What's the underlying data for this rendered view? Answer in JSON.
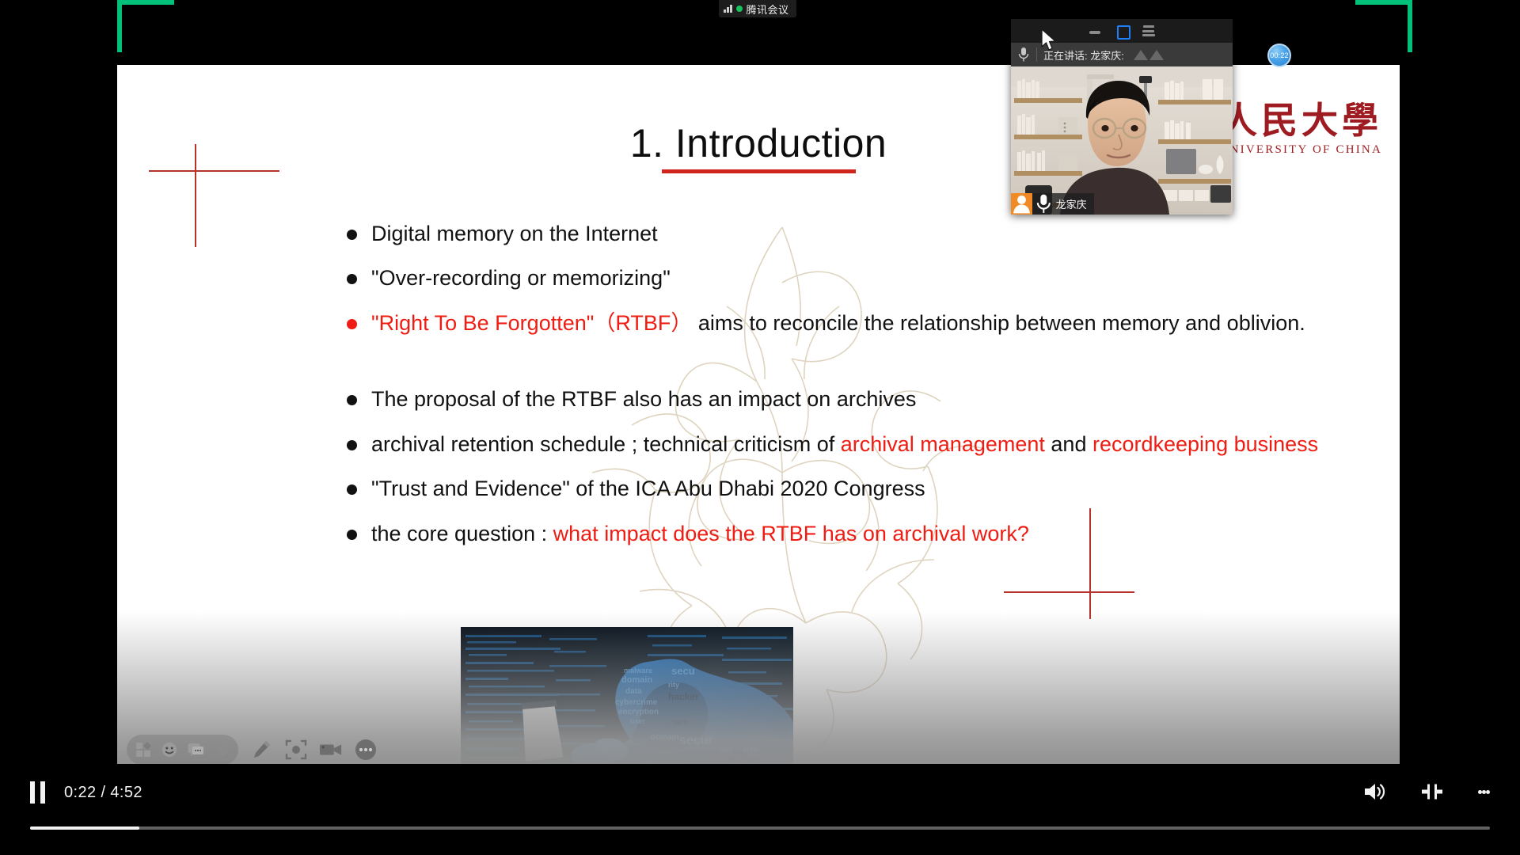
{
  "meeting_badge": {
    "label": "腾讯会议",
    "signal_icon": "signal-bars-icon",
    "status_icon": "green-dot-icon"
  },
  "timer_pill": {
    "value": "00:22"
  },
  "pip_window": {
    "titlebar": {
      "minimize_icon": "minimize-icon",
      "maximize_icon": "maximize-icon",
      "menu_icon": "hamburger-menu-icon"
    },
    "speaking_bar": {
      "mic_icon": "microphone-icon",
      "text": "正在讲话: 龙家庆:",
      "wave_icon": "audio-wave-icon"
    },
    "nametag": {
      "avatar_icon": "person-avatar-icon",
      "mic_icon": "microphone-icon",
      "name": "龙家庆"
    }
  },
  "slide": {
    "title": "1. Introduction",
    "university_logo": {
      "cn": "国人民大學",
      "en": "IN UNIVERSITY OF CHINA"
    },
    "bullets": [
      {
        "color": "black",
        "segments": [
          {
            "text": "Digital memory on the Internet",
            "color": "black"
          }
        ]
      },
      {
        "color": "black",
        "segments": [
          {
            "text": "\"Over-recording or memorizing\"",
            "color": "black"
          }
        ]
      },
      {
        "color": "red",
        "segments": [
          {
            "text": "\"Right To Be Forgotten\"（RTBF）",
            "color": "red"
          },
          {
            "text": " aims to reconcile the relationship between memory and oblivion.",
            "color": "black"
          }
        ]
      },
      {
        "color": "black",
        "spacer_before": true,
        "segments": [
          {
            "text": "The proposal of the RTBF also has an impact on archives",
            "color": "black"
          }
        ]
      },
      {
        "color": "black",
        "segments": [
          {
            "text": "archival retention schedule ; technical criticism of ",
            "color": "black"
          },
          {
            "text": "archival management",
            "color": "red"
          },
          {
            "text": " and ",
            "color": "black"
          },
          {
            "text": "recordkeeping business",
            "color": "red"
          }
        ]
      },
      {
        "color": "black",
        "segments": [
          {
            "text": "\"Trust and Evidence\" of the ICA Abu Dhabi 2020 Congress",
            "color": "black"
          }
        ]
      },
      {
        "color": "black",
        "segments": [
          {
            "text": "the core question : ",
            "color": "black"
          },
          {
            "text": "what impact does the RTBF has on archival work?",
            "color": "red"
          }
        ]
      }
    ],
    "image": {
      "name": "hacker-cybercrime-photo",
      "alt": "hooded hacker at laptop with blue code overlay"
    }
  },
  "annotation_toolbar": {
    "items": [
      {
        "name": "shapes-tool",
        "icon": "shapes-icon"
      },
      {
        "name": "emoji-tool",
        "icon": "smiley-icon"
      },
      {
        "name": "comment-tool",
        "icon": "chat-bubble-icon"
      },
      {
        "name": "collapse-tool",
        "icon": "chevron-left-icon"
      },
      {
        "name": "pen-tool",
        "icon": "pencil-icon"
      },
      {
        "name": "screenshot-tool",
        "icon": "focus-capture-icon"
      },
      {
        "name": "record-tool",
        "icon": "video-camera-icon"
      },
      {
        "name": "more-tool",
        "icon": "ellipsis-icon"
      }
    ]
  },
  "player": {
    "pause_icon": "pause-icon",
    "time": "0:22 / 4:52",
    "current_time": "0:22",
    "duration": "4:52",
    "progress_percent": 7.5,
    "volume_icon": "volume-on-icon",
    "exit_fullscreen_icon": "exit-fullscreen-icon",
    "more_options_icon": "vertical-ellipsis-icon"
  },
  "colors": {
    "accent_red": "#ee1c12",
    "title_rule": "#d0241c",
    "corner_green": "#00c07a",
    "logo_red": "#9e1c21",
    "pip_blue": "#1f7ff5",
    "avatar_orange": "#f08a24"
  }
}
